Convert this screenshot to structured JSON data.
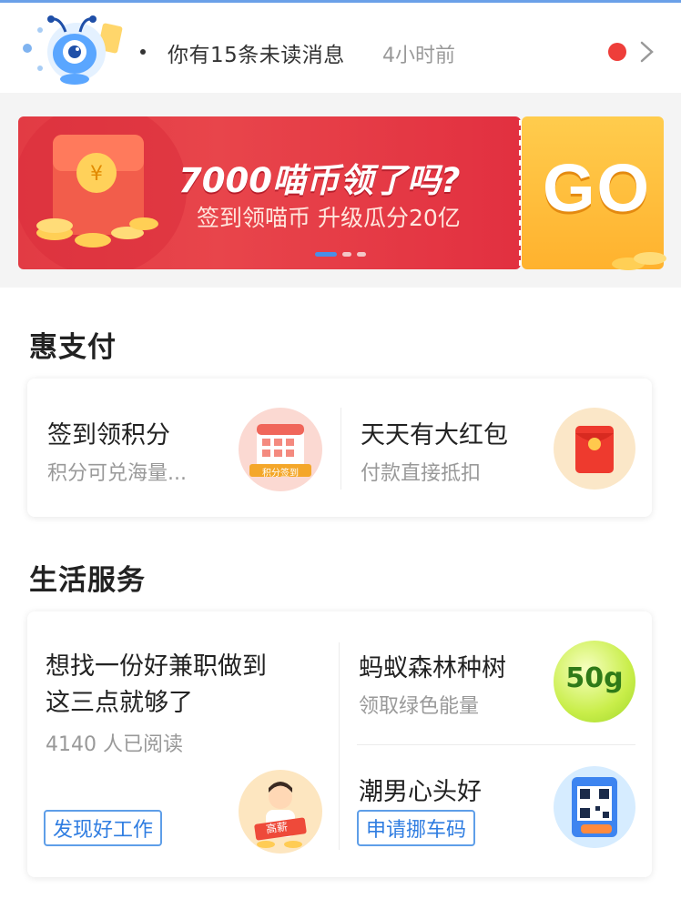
{
  "notification": {
    "text": "你有15条未读消息",
    "time": "4小时前",
    "icons": [
      "ant-mascot-icon",
      "red-dot-icon",
      "chevron-right-icon"
    ]
  },
  "banner": {
    "title": "7000喵币领了吗?",
    "subtitle": "签到领喵币 升级瓜分20亿",
    "go_label": "GO",
    "pager": {
      "count": 3,
      "active_index": 0
    }
  },
  "sections": {
    "pay": {
      "title": "惠支付",
      "items": [
        {
          "title": "签到领积分",
          "subtitle": "积分可兑海量...",
          "icon": "calendar-checkin-icon",
          "icon_caption": "积分签到"
        },
        {
          "title": "天天有大红包",
          "subtitle": "付款直接抵扣",
          "icon": "red-envelope-icon"
        }
      ]
    },
    "life": {
      "title": "生活服务",
      "feature": {
        "title_line1": "想找一份好兼职做到",
        "title_line2": "这三点就够了",
        "reads": "4140 人已阅读",
        "tag": "发现好工作",
        "icon": "job-person-icon",
        "icon_caption": "高薪"
      },
      "items": [
        {
          "title": "蚂蚁森林种树",
          "subtitle": "领取绿色能量",
          "icon": "energy-ball-icon",
          "icon_text": "50g"
        },
        {
          "title": "潮男心头好",
          "tag": "申请挪车码",
          "icon": "qr-code-icon"
        }
      ]
    }
  },
  "colors": {
    "accent_blue": "#2f7de1",
    "banner_red": "#e23b44",
    "go_yellow": "#ffb22e",
    "notif_red": "#ee3e3a"
  }
}
